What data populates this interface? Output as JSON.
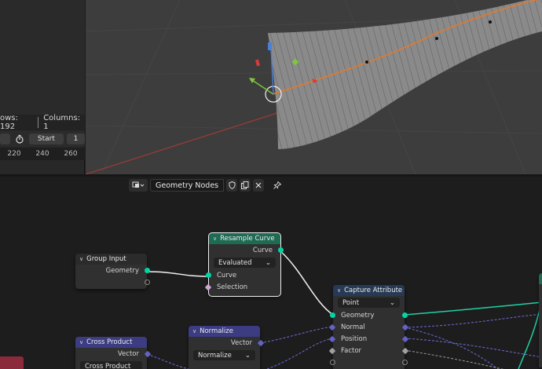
{
  "spreadsheet": {
    "rows_label": "ows: 192",
    "columns_label": "Columns: 1",
    "start_label": "Start",
    "start_value": "1",
    "timeline_ticks": [
      "220",
      "240",
      "260"
    ]
  },
  "editor": {
    "tree_name": "Geometry Nodes"
  },
  "nodes": {
    "group_input": {
      "title": "Group Input",
      "out_geometry": "Geometry"
    },
    "resample_curve": {
      "title": "Resample Curve",
      "out_curve": "Curve",
      "mode": "Evaluated",
      "in_curve": "Curve",
      "in_selection": "Selection"
    },
    "capture_attribute": {
      "title": "Capture Attribute",
      "domain": "Point",
      "geometry": "Geometry",
      "normal": "Normal",
      "position": "Position",
      "factor": "Factor"
    },
    "cross_product": {
      "title": "Cross Product",
      "out_vector": "Vector",
      "operation": "Cross Product"
    },
    "normalize": {
      "title": "Normalize",
      "out_vector": "Vector",
      "operation": "Normalize"
    }
  },
  "colors": {
    "geometry_socket": "#00d6a3",
    "vector_socket": "#6363c7",
    "geometry_header": "#1e6b53",
    "vector_header": "#3c3c83",
    "input_header": "#2b2b2b",
    "viewport_bg": "#3d3d3d"
  }
}
